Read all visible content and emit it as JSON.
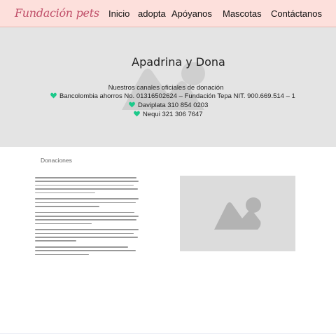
{
  "nav": {
    "logo": "Fundación pets",
    "links": [
      "Inicio",
      "adopta",
      "Apóyanos",
      "Mascotas",
      "Contáctanos"
    ]
  },
  "hero": {
    "title": "Apadrina y Dona",
    "subtitle": "Nuestros canales oficiales de donación",
    "lines": [
      "Bancolombia ahorros No. 01316502624 – Fundación Tepa NIT. 900.669.514 – 1",
      "Daviplata 310 854 0203",
      "Nequi 321 306 7647"
    ]
  },
  "donations": {
    "title": "Donaciones"
  },
  "colors": {
    "navbar": "#fde0dc",
    "logo": "#c0506a",
    "hero": "#e4e4e4",
    "heart": "#1cc98a",
    "placeholder": "#dcdcdc"
  },
  "icons": [
    "heart-icon",
    "image-placeholder-icon"
  ]
}
